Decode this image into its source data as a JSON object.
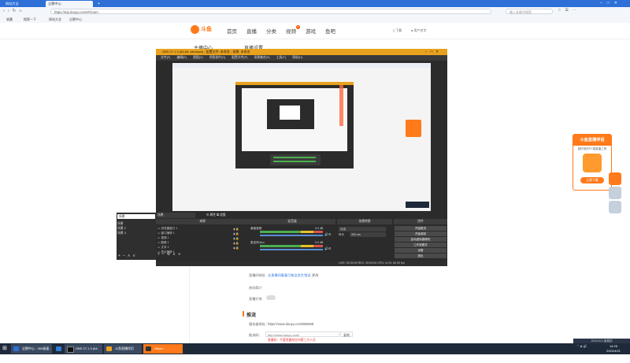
{
  "browser": {
    "tabs": [
      "网站大全",
      "企鹅中心",
      "企鹅中心"
    ],
    "url": "https://mp.douyu.com/#/room",
    "search_placeholder": "输入关键字搜索",
    "bookmarks": [
      "收藏",
      "搜索一下",
      "网站大全",
      "企鹅中心"
    ]
  },
  "site": {
    "logo_text": "斗鱼",
    "nav": [
      "首页",
      "直播",
      "分类",
      "视频",
      "游戏",
      "鱼吧"
    ],
    "nav_badge": "3",
    "download": "下载",
    "user": "用户名字",
    "sidebar_title": "主播中心",
    "section_title": "直播设置"
  },
  "obs": {
    "title": "OBS 27.1.3 (64-bit, windows) - 配置文件: 未命名 - 场景: 未命名",
    "menu": [
      "文件(F)",
      "编辑(E)",
      "视图(V)",
      "停靠部件(D)",
      "配置文件(P)",
      "场景集合(S)",
      "工具(T)",
      "帮助(H)"
    ],
    "panel_headers": [
      "场景",
      "来源",
      "混音器",
      "场景转换",
      "控件"
    ],
    "scenes": [
      "场景",
      "场景 2",
      "场景 3"
    ],
    "sources": [
      "浏览器窗口 1",
      "窗口捕获 1",
      "视频 1",
      "图像 1",
      "文本 1",
      "显示捕获 1"
    ],
    "mixer": [
      {
        "name": "桌面音频",
        "level": "0.0 dB"
      },
      {
        "name": "麦克风/Aux",
        "level": "0.0 dB"
      }
    ],
    "transition": {
      "type": "淡出",
      "duration_label": "时长",
      "duration": "300 ms"
    },
    "controls": [
      "开始推流",
      "开始录制",
      "启动虚拟摄像机",
      "工作室模式",
      "设置",
      "退出"
    ],
    "status": "LIVE: 00:00:00   REC: 00:00:00   CPU: 4.1%, 60.00 fps",
    "source_props": [
      "属性",
      "滤镜"
    ]
  },
  "form": {
    "rows": [
      {
        "label": "直播间地址",
        "value": "去直播间看看可能会发生错误",
        "extra": "更改"
      },
      {
        "label": "房间简介",
        "value": ""
      },
      {
        "label": "直播开关",
        "value": ""
      }
    ],
    "push_section": "推流",
    "server_label": "服务器地址：",
    "server_value": "https://www.douyu.com/960668",
    "key_label": "推流码：",
    "key_value": "http://www.douyu.com/",
    "key_btn": "复制",
    "warning": "直播码：不要泄露给任何第三方人员"
  },
  "promo": {
    "title": "斗鱼直播伴侣",
    "subtitle": "超好用的PC端直播工具",
    "button": "立即下载"
  },
  "taskbar": {
    "items": [
      "企鹅中心 - 360极速...",
      "",
      "OBS 27.1.3 (64-bit...",
      "斗鱼直播伴侣",
      "Steam"
    ],
    "time": "14:25",
    "date": "2022/4/21",
    "tray_text": "2022/4/21 星期四"
  },
  "colors": {
    "brand": "#ff7a1a",
    "obs_title": "#e9a21e",
    "browser_blue": "#2e6fd8",
    "taskbar": "#1e2a3a"
  }
}
